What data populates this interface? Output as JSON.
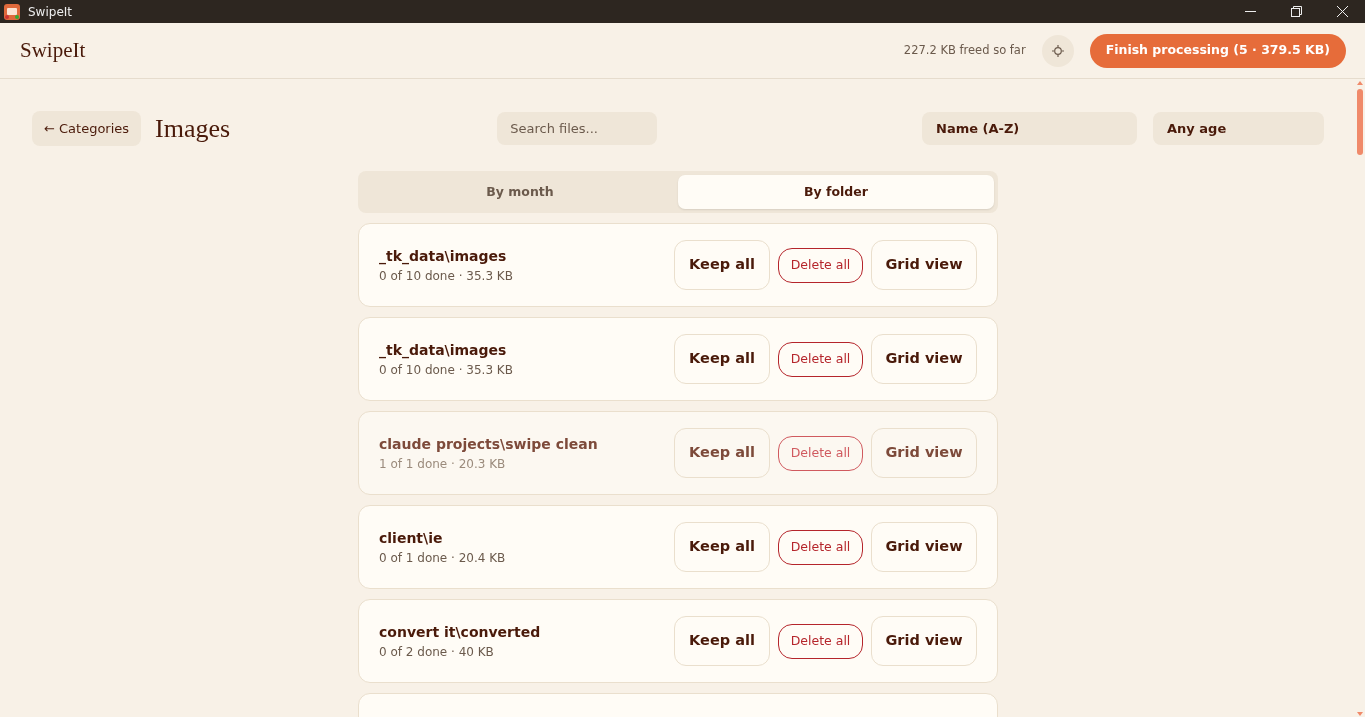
{
  "window": {
    "title": "SwipeIt"
  },
  "header": {
    "brand": "SwipeIt",
    "freed": "227.2 KB freed so far",
    "finish_button": "Finish processing (5 · 379.5 KB)"
  },
  "toolbar": {
    "back_button": "← Categories",
    "title": "Images",
    "search": {
      "placeholder": "Search files..."
    },
    "sort": "Name (A-Z)",
    "age": "Any age"
  },
  "tabs": [
    {
      "label": "By month",
      "selected": false
    },
    {
      "label": "By folder",
      "selected": true
    }
  ],
  "folders": [
    {
      "name": "_tk_data\\images",
      "progress": "0 of 10 done · 35.3 KB",
      "done": false,
      "keep": "Keep all",
      "delete": "Delete all",
      "grid": "Grid view"
    },
    {
      "name": "_tk_data\\images",
      "progress": "0 of 10 done · 35.3 KB",
      "done": false,
      "keep": "Keep all",
      "delete": "Delete all",
      "grid": "Grid view"
    },
    {
      "name": "claude projects\\swipe clean",
      "progress": "1 of 1 done · 20.3 KB",
      "done": true,
      "keep": "Keep all",
      "delete": "Delete all",
      "grid": "Grid view"
    },
    {
      "name": "client\\ie",
      "progress": "0 of 1 done · 20.4 KB",
      "done": false,
      "keep": "Keep all",
      "delete": "Delete all",
      "grid": "Grid view"
    },
    {
      "name": "convert it\\converted",
      "progress": "0 of 2 done · 40 KB",
      "done": false,
      "keep": "Keep all",
      "delete": "Delete all",
      "grid": "Grid view"
    }
  ]
}
